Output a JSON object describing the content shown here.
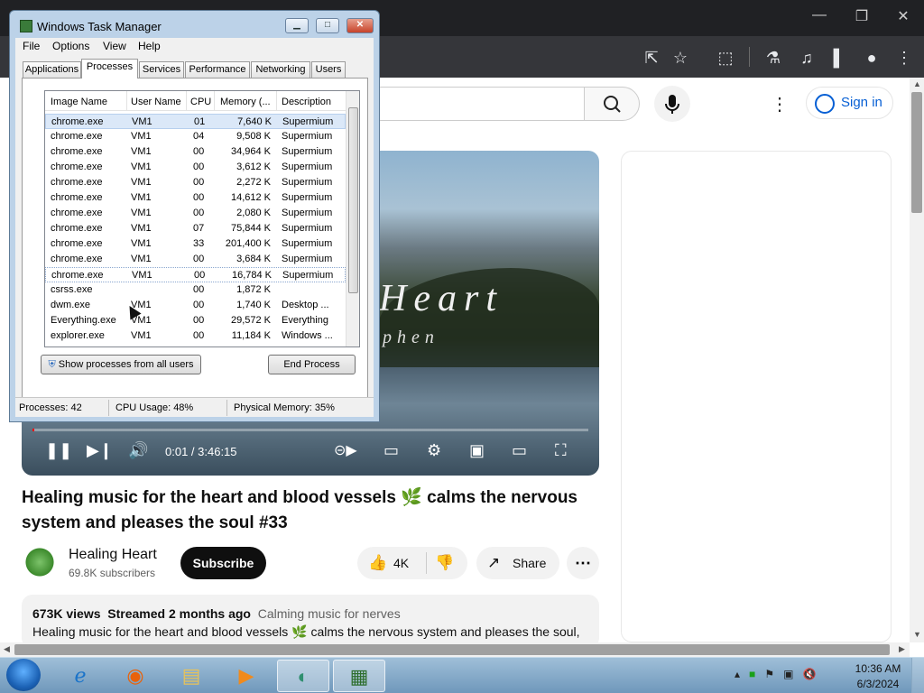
{
  "browser": {
    "window_controls": {
      "minimize": "—",
      "maximize": "❐",
      "close": "✕"
    },
    "toolbar_icons": [
      "install-app-icon",
      "star-icon",
      "extensions-icon",
      "labs-icon",
      "media-icon",
      "sidepanel-icon",
      "profile-icon",
      "menu-icon"
    ]
  },
  "youtube": {
    "signin_label": "Sign in",
    "player": {
      "overlay_title": "Heart",
      "overlay_subtitle": "phen",
      "time_current": "0:01",
      "time_total": "3:46:15",
      "time_display": "0:01 / 3:46:15",
      "progress": 0.0001
    },
    "video": {
      "title": "Healing music for the heart and blood vessels 🌿 calms the nervous system and pleases the soul #33",
      "channel_name": "Healing Heart",
      "subscribers": "69.8K subscribers",
      "subscribe_label": "Subscribe",
      "likes": "4K",
      "share_label": "Share",
      "views": "673K views",
      "streamed": "Streamed 2 months ago",
      "tag": "Calming music for nerves",
      "description": "Healing music for the heart and blood vessels 🌿 calms the nervous system and pleases the soul,"
    }
  },
  "taskmgr": {
    "title": "Windows Task Manager",
    "menu": [
      "File",
      "Options",
      "View",
      "Help"
    ],
    "tabs": [
      "Applications",
      "Processes",
      "Services",
      "Performance",
      "Networking",
      "Users"
    ],
    "selected_tab": "Processes",
    "columns": [
      "Image Name",
      "User Name",
      "CPU",
      "Memory (...",
      "Description"
    ],
    "rows": [
      [
        "chrome.exe",
        "VM1",
        "01",
        "7,640 K",
        "Supermium"
      ],
      [
        "chrome.exe",
        "VM1",
        "04",
        "9,508 K",
        "Supermium"
      ],
      [
        "chrome.exe",
        "VM1",
        "00",
        "34,964 K",
        "Supermium"
      ],
      [
        "chrome.exe",
        "VM1",
        "00",
        "3,612 K",
        "Supermium"
      ],
      [
        "chrome.exe",
        "VM1",
        "00",
        "2,272 K",
        "Supermium"
      ],
      [
        "chrome.exe",
        "VM1",
        "00",
        "14,612 K",
        "Supermium"
      ],
      [
        "chrome.exe",
        "VM1",
        "00",
        "2,080 K",
        "Supermium"
      ],
      [
        "chrome.exe",
        "VM1",
        "07",
        "75,844 K",
        "Supermium"
      ],
      [
        "chrome.exe",
        "VM1",
        "33",
        "201,400 K",
        "Supermium"
      ],
      [
        "chrome.exe",
        "VM1",
        "00",
        "3,684 K",
        "Supermium"
      ],
      [
        "chrome.exe",
        "VM1",
        "00",
        "16,784 K",
        "Supermium"
      ],
      [
        "csrss.exe",
        "",
        "00",
        "1,872 K",
        ""
      ],
      [
        "dwm.exe",
        "VM1",
        "00",
        "1,740 K",
        "Desktop ..."
      ],
      [
        "Everything.exe",
        "VM1",
        "00",
        "29,572 K",
        "Everything"
      ],
      [
        "explorer.exe",
        "VM1",
        "00",
        "11,184 K",
        "Windows ..."
      ]
    ],
    "show_all_label": "Show processes from all users",
    "end_process_label": "End Process",
    "status": {
      "processes": "Processes: 42",
      "cpu": "CPU Usage: 48%",
      "memory": "Physical Memory: 35%"
    }
  },
  "taskbar": {
    "apps": [
      "start-orb",
      "internet-explorer-icon",
      "firefox-icon",
      "explorer-folder-icon",
      "media-player-icon",
      "supermium-icon",
      "task-manager-icon"
    ],
    "time": "10:36 AM",
    "date": "6/3/2024"
  }
}
